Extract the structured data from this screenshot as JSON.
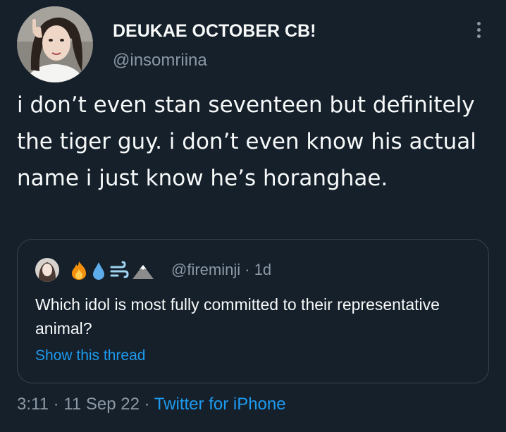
{
  "tweet": {
    "display_name": "DEUKAE OCTOBER CB!",
    "handle": "@insomriina",
    "text": "i don’t even stan seventeen but definitely the tiger guy. i don’t even know his actual name i just know he’s horanghae.",
    "time": "3:11",
    "separator": "·",
    "date": "11 Sep 22",
    "source": "Twitter for iPhone"
  },
  "quote": {
    "emojis": [
      "fire-emoji",
      "droplet-emoji",
      "wind-emoji",
      "mountain-emoji"
    ],
    "handle": "@fireminji",
    "age": "· 1d",
    "text": "Which idol is most fully committed to their representative animal?",
    "show_thread_label": "Show this thread"
  },
  "colors": {
    "background": "#15202b",
    "text_primary": "#f7f9f9",
    "text_secondary": "#8b98a5",
    "accent": "#1d9bf0",
    "border": "#38444d"
  }
}
